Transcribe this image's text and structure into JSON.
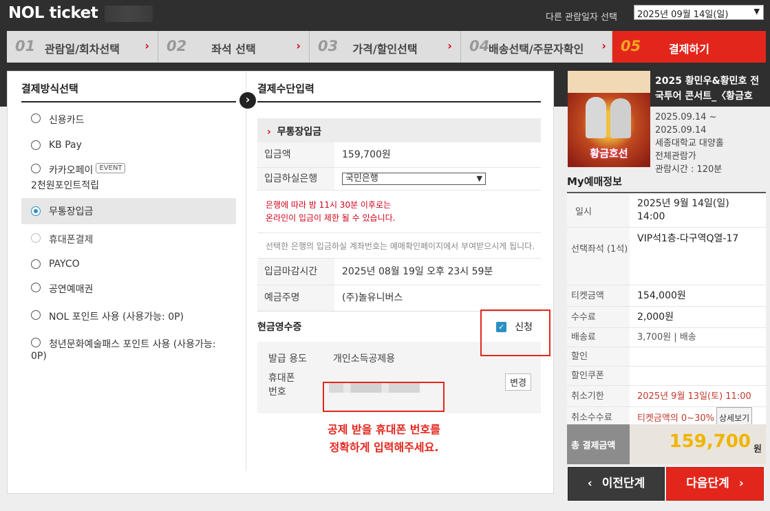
{
  "header": {
    "logo": "NOL ticket",
    "date_label": "다른 관람일자 선택",
    "date_value": "2025년 09월 14일(일)"
  },
  "steps": [
    {
      "num": "01",
      "label": "관람일/회차선택",
      "active": false
    },
    {
      "num": "02",
      "label": "좌석 선택",
      "active": false
    },
    {
      "num": "03",
      "label": "가격/할인선택",
      "active": false
    },
    {
      "num": "04",
      "label": "배송선택/주문자확인",
      "active": false
    },
    {
      "num": "05",
      "label": "결제하기",
      "active": true
    }
  ],
  "payment_methods": {
    "title": "결제방식선택",
    "items": [
      {
        "label": "신용카드"
      },
      {
        "label": "KB Pay"
      },
      {
        "label": "카카오페이",
        "badge": "EVENT",
        "sub": "2천원포인트적립"
      },
      {
        "label": "무통장입금",
        "selected": true
      },
      {
        "label": "휴대폰결제",
        "disabled": true
      },
      {
        "label": "PAYCO"
      },
      {
        "label": "공연예매권"
      },
      {
        "label": "NOL 포인트 사용 (사용가능: 0P)"
      },
      {
        "label": "청년문화예술패스 포인트 사용 (사용가능:",
        "sub": "0P)"
      }
    ]
  },
  "payment_input": {
    "title": "결제수단입력",
    "sub_title": "무통장입금",
    "amount_label": "입금액",
    "amount_value": "159,700원",
    "bank_label": "입금하실은행",
    "bank_value": "국민은행",
    "notice_red": [
      "은행에 따라 밤 11시 30분 이후로는",
      "온라인이 입금이 제한 될 수 있습니다."
    ],
    "notice_gray": "선택한 은행의 입금하실 계좌번호는 예매확인페이지에서 부여받으시게 됩니다.",
    "deadline_label": "입금마감시간",
    "deadline_value": "2025년 08월 19일 오후 23시 59분",
    "depositor_label": "예금주명",
    "depositor_value": "(주)놀유니버스",
    "receipt_label": "현금영수증",
    "receipt_apply": "신청",
    "issue_use_label": "발급 용도",
    "issue_use_value": "개인소득공제용",
    "phone_label": "휴대폰번호",
    "change_button": "변경",
    "warning": [
      "공제 받을 휴대폰 번호를",
      "정확하게 입력해주세요."
    ]
  },
  "show": {
    "poster_title": "황금호선",
    "title": "2025 황민우&황민호 전국투어 콘서트_〈황금호",
    "date_from": "2025.09.14 ~",
    "date_to": "2025.09.14",
    "venue": "세종대학교 대양홀",
    "age": "전체관람가",
    "runtime": "관람시간 : 120분"
  },
  "my_booking": {
    "title": "My예매정보",
    "rows": [
      {
        "key": "일시",
        "value": "2025년 9월 14일(일) 14:00"
      },
      {
        "key": "선택좌석 (1석)",
        "value": "VIP석1층-다구역Q열-17"
      },
      {
        "key": "티켓금액",
        "value": "154,000원"
      },
      {
        "key": "수수료",
        "value": "2,000원"
      },
      {
        "key": "배송료",
        "value": "3,700원 | 배송"
      },
      {
        "key": "할인",
        "value": ""
      },
      {
        "key": "할인쿠폰",
        "value": ""
      },
      {
        "key": "취소기한",
        "value": "2025년 9월 13일(토) 11:00"
      },
      {
        "key": "취소수수료",
        "value": "티켓금액의 0~30%",
        "button": "상세보기"
      }
    ],
    "total_label": "총 결제금액",
    "total_value": "159,700",
    "total_unit": "원"
  },
  "nav": {
    "prev": "이전단계",
    "next": "다음단계"
  },
  "colors": {
    "accent_red": "#e3261c",
    "total_yellow": "#f0b400",
    "radio_blue": "#2b8fc2"
  }
}
